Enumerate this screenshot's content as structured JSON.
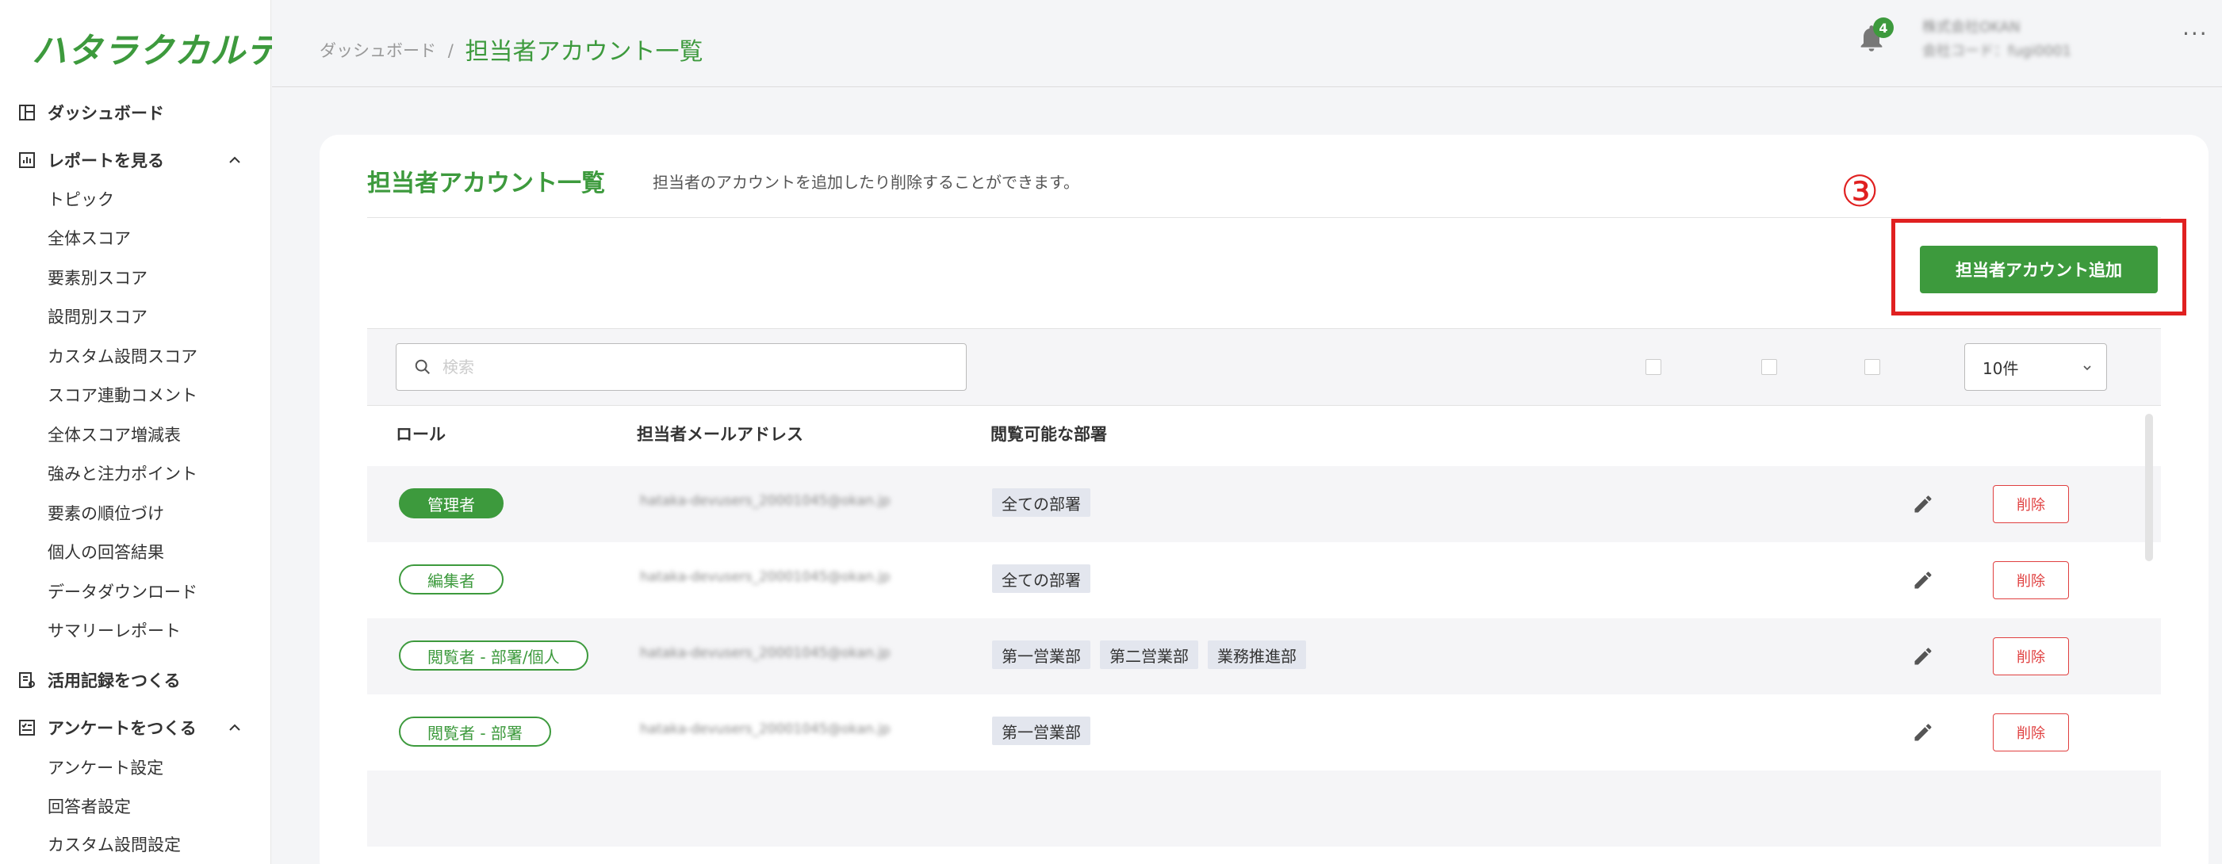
{
  "app": {
    "logo": "ハタラクカルテ"
  },
  "sidebar": {
    "dashboard": "ダッシュボード",
    "reports": {
      "label": "レポートを見る",
      "items": [
        "トピック",
        "全体スコア",
        "要素別スコア",
        "設問別スコア",
        "カスタム設問スコア",
        "スコア連動コメント",
        "全体スコア増減表",
        "強みと注力ポイント",
        "要素の順位づけ",
        "個人の回答結果",
        "データダウンロード",
        "サマリーレポート"
      ]
    },
    "activity": "活用記録をつくる",
    "survey": {
      "label": "アンケートをつくる",
      "items": [
        "アンケート設定",
        "回答者設定",
        "カスタム設問設定"
      ]
    }
  },
  "header": {
    "breadcrumb_root": "ダッシュボード",
    "breadcrumb_sep": "/",
    "breadcrumb_current": "担当者アカウント一覧",
    "notification_count": "4",
    "company_name": "株式会社OKAN",
    "company_code": "会社コード：fugi0001",
    "more": "···"
  },
  "main": {
    "title": "担当者アカウント一覧",
    "description": "担当者のアカウントを追加したり削除することができます。",
    "step_marker": "③",
    "add_button": "担当者アカウント追加",
    "search_placeholder": "検索",
    "page_size": "10件",
    "columns": {
      "role": "ロール",
      "email": "担当者メールアドレス",
      "departments": "閲覧可能な部署"
    },
    "rows": [
      {
        "role": "管理者",
        "email": "hataka-devusers_20001045@okan.jp",
        "departments": [
          "全ての部署"
        ]
      },
      {
        "role": "編集者",
        "email": "hataka-devusers_20001045@okan.jp",
        "departments": [
          "全ての部署"
        ]
      },
      {
        "role": "閲覧者 - 部署/個人",
        "email": "hataka-devusers_20001045@okan.jp",
        "departments": [
          "第一営業部",
          "第二営業部",
          "業務推進部"
        ]
      },
      {
        "role": "閲覧者 - 部署",
        "email": "hataka-devusers_20001045@okan.jp",
        "departments": [
          "第一営業部"
        ]
      }
    ],
    "delete_label": "削除"
  },
  "colors": {
    "brand_green": "#3d9a3d",
    "danger_red": "#e04040",
    "highlight_red": "#e02020"
  }
}
